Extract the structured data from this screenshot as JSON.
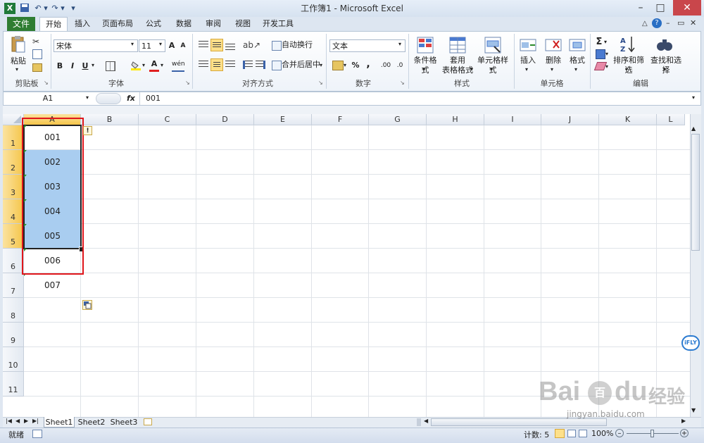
{
  "window": {
    "title": "工作簿1 - Microsoft Excel",
    "controls": [
      "–",
      "□",
      "✕"
    ]
  },
  "qat": {
    "undo": "↶",
    "redo": "↷",
    "dropdown": "▾"
  },
  "tabs": [
    {
      "label": "文件",
      "active": false
    },
    {
      "label": "开始",
      "active": true
    },
    {
      "label": "插入",
      "active": false
    },
    {
      "label": "页面布局",
      "active": false
    },
    {
      "label": "公式",
      "active": false
    },
    {
      "label": "数据",
      "active": false
    },
    {
      "label": "审阅",
      "active": false
    },
    {
      "label": "视图",
      "active": false
    },
    {
      "label": "开发工具",
      "active": false
    }
  ],
  "ribbon": {
    "clipboard": {
      "paste_label": "粘贴",
      "group_label": "剪贴板"
    },
    "font": {
      "font_name": "宋体",
      "font_size": "11",
      "bold": "B",
      "italic": "I",
      "underline": "U",
      "grow": "A",
      "shrink": "A",
      "font_color": "A",
      "wen": "wén",
      "group_label": "字体"
    },
    "alignment": {
      "wrap_text": "自动换行",
      "merge_center": "合并后居中",
      "group_label": "对齐方式"
    },
    "number": {
      "format": "文本",
      "percent": "%",
      "comma": ",",
      "inc_decimal": ".00",
      "dec_decimal": ".0",
      "group_label": "数字"
    },
    "styles": {
      "conditional": "条件格式",
      "table_format_1": "套用",
      "table_format_2": "表格格式",
      "cell_styles": "单元格样式",
      "group_label": "样式"
    },
    "cells": {
      "insert": "插入",
      "delete": "删除",
      "format": "格式",
      "group_label": "单元格"
    },
    "editing": {
      "sum": "Σ",
      "sort_filter": "排序和筛选",
      "find_select": "查找和选择",
      "group_label": "编辑"
    }
  },
  "formula_bar": {
    "name_box": "A1",
    "fx": "fx",
    "content": "001"
  },
  "columns": [
    "A",
    "B",
    "C",
    "D",
    "E",
    "F",
    "G",
    "H",
    "I",
    "J",
    "K",
    "L"
  ],
  "rows": [
    "1",
    "2",
    "3",
    "4",
    "5",
    "6",
    "7",
    "8",
    "9",
    "10",
    "11"
  ],
  "cells_a": [
    "001",
    "002",
    "003",
    "004",
    "005",
    "006",
    "007"
  ],
  "sheets": [
    "Sheet1",
    "Sheet2",
    "Sheet3"
  ],
  "status": {
    "ready": "就绪",
    "count": "计数: 5",
    "zoom": "100%"
  },
  "watermark": {
    "brand": "Bai",
    "brand2": "百",
    "cn": "经验",
    "url": "jingyan.baidu.com",
    "ifly": "iFLY"
  },
  "colors": {
    "file_tab": "#2f7d32",
    "selection": "#a9cdf0",
    "highlight_box": "#e0161b",
    "header_selected": "#f5c54a"
  }
}
